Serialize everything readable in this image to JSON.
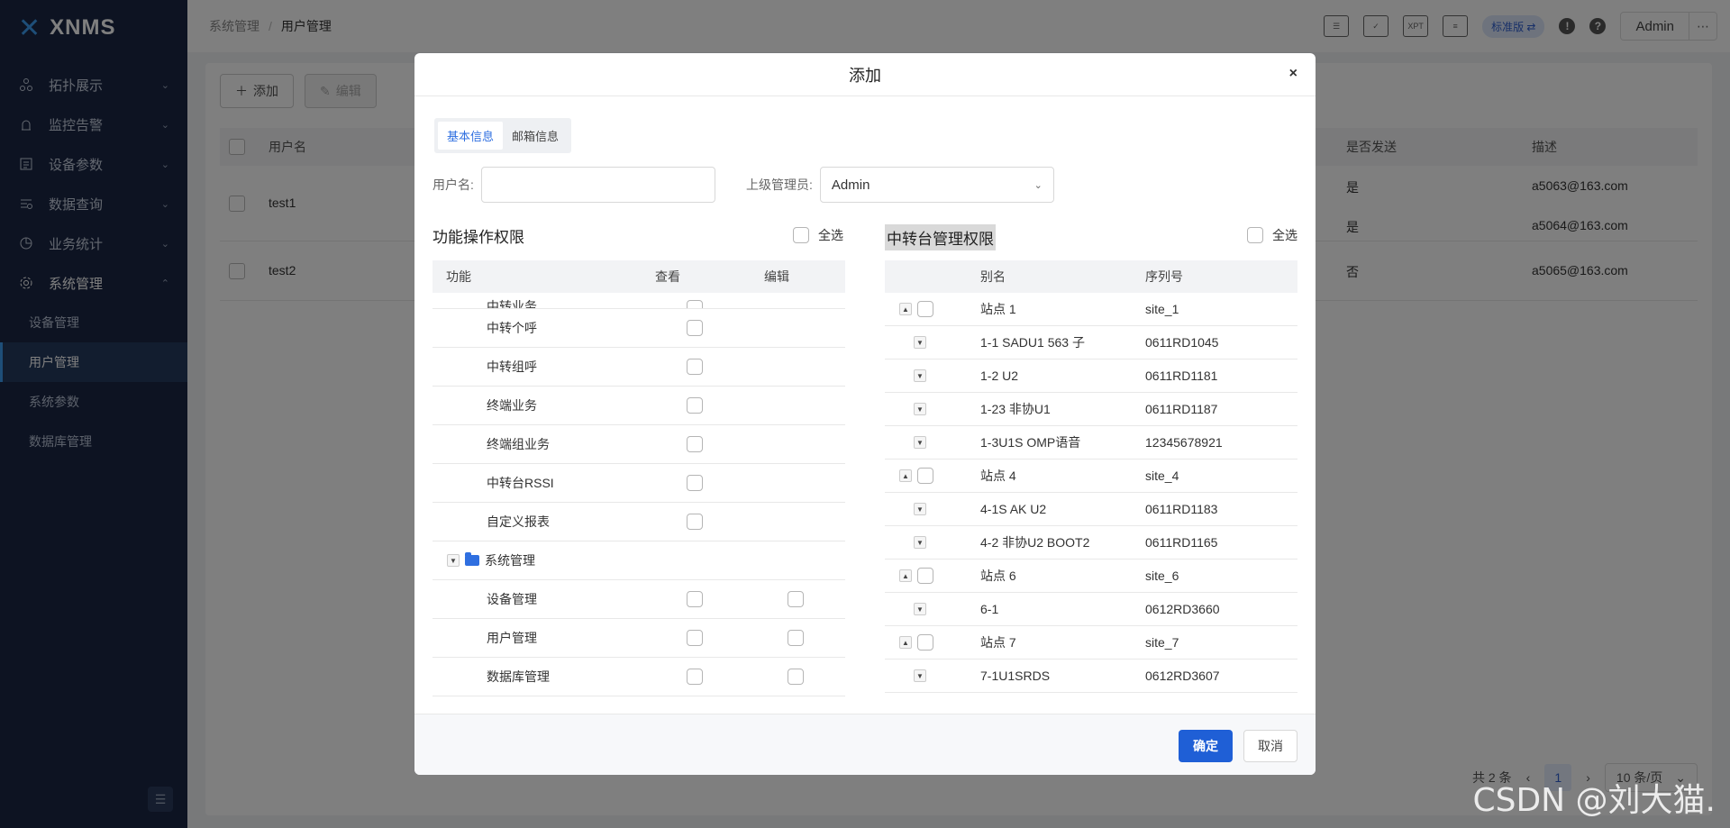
{
  "app": {
    "logo_text": "XNMS"
  },
  "sidebar": {
    "menus": [
      {
        "label": "拓扑展示",
        "icon": "topology-icon"
      },
      {
        "label": "监控告警",
        "icon": "alarm-icon"
      },
      {
        "label": "设备参数",
        "icon": "device-params-icon"
      },
      {
        "label": "数据查询",
        "icon": "data-query-icon"
      },
      {
        "label": "业务统计",
        "icon": "statistics-icon"
      },
      {
        "label": "系统管理",
        "icon": "gear-icon"
      }
    ],
    "submenu": [
      "设备管理",
      "用户管理",
      "系统参数",
      "数据库管理"
    ],
    "active_submenu": "用户管理"
  },
  "header": {
    "breadcrumb": [
      "系统管理",
      "用户管理"
    ],
    "edition": "标准版 ⇄",
    "user": "Admin",
    "icons": [
      "monitor-list-icon",
      "screen-check-icon",
      "xpt-icon",
      "report-icon"
    ],
    "xpt_label": "XPT"
  },
  "main": {
    "toolbar": {
      "add": "添加",
      "edit": "编辑"
    },
    "columns": {
      "username": "用户名",
      "send": "是否发送",
      "desc": "描述"
    },
    "rows": [
      {
        "username": "test1",
        "send": [
          "是",
          "是"
        ],
        "desc": [
          "a5063@163.com",
          "a5064@163.com"
        ]
      },
      {
        "username": "test2",
        "send": [
          "否"
        ],
        "desc": [
          "a5065@163.com"
        ]
      }
    ],
    "pager": {
      "total": "共 2 条",
      "page": "1",
      "size": "10 条/页"
    }
  },
  "modal": {
    "title": "添加",
    "close": "×",
    "tabs": [
      "基本信息",
      "邮箱信息"
    ],
    "active_tab": "基本信息",
    "username_label": "用户名:",
    "username_value": "",
    "manager_label": "上级管理员:",
    "manager_value": "Admin",
    "left": {
      "title": "功能操作权限",
      "select_all": "全选",
      "columns": {
        "func": "功能",
        "view": "查看",
        "edit": "编辑"
      },
      "rows": [
        {
          "label": "中转业务",
          "view": true,
          "edit": false,
          "partial": true
        },
        {
          "label": "中转个呼",
          "view": true,
          "edit": false
        },
        {
          "label": "中转组呼",
          "view": true,
          "edit": false
        },
        {
          "label": "终端业务",
          "view": true,
          "edit": false
        },
        {
          "label": "终端组业务",
          "view": true,
          "edit": false
        },
        {
          "label": "中转台RSSI",
          "view": true,
          "edit": false
        },
        {
          "label": "自定义报表",
          "view": true,
          "edit": false
        },
        {
          "label": "系统管理",
          "group": true
        },
        {
          "label": "设备管理",
          "view": true,
          "edit": true
        },
        {
          "label": "用户管理",
          "view": true,
          "edit": true
        },
        {
          "label": "数据库管理",
          "view": true,
          "edit": true
        }
      ]
    },
    "right": {
      "title": "中转台管理权限",
      "select_all": "全选",
      "columns": {
        "alias": "别名",
        "serial": "序列号"
      },
      "rows": [
        {
          "alias": "站点 1",
          "serial": "site_1",
          "site": true
        },
        {
          "alias": "1-1 SADU1 563 子",
          "serial": "0611RD1045"
        },
        {
          "alias": "1-2 U2",
          "serial": "0611RD1181"
        },
        {
          "alias": "1-23 非协U1",
          "serial": "0611RD1187"
        },
        {
          "alias": "1-3U1S OMP语音",
          "serial": "12345678921"
        },
        {
          "alias": "站点 4",
          "serial": "site_4",
          "site": true
        },
        {
          "alias": "4-1S AK U2",
          "serial": "0611RD1183"
        },
        {
          "alias": "4-2 非协U2 BOOT2",
          "serial": "0611RD1165"
        },
        {
          "alias": "站点 6",
          "serial": "site_6",
          "site": true
        },
        {
          "alias": "6-1",
          "serial": "0612RD3660"
        },
        {
          "alias": "站点 7",
          "serial": "site_7",
          "site": true
        },
        {
          "alias": "7-1U1SRDS",
          "serial": "0612RD3607"
        }
      ]
    },
    "ok": "确定",
    "cancel": "取消"
  },
  "watermark": "CSDN @刘大猫."
}
